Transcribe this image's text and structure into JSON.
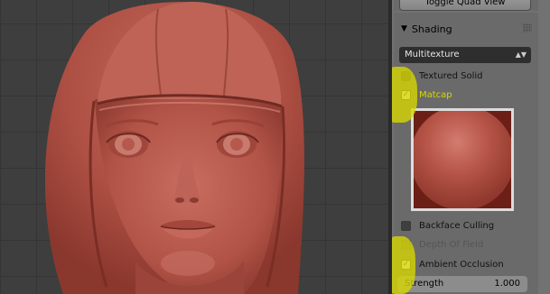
{
  "panel": {
    "toggle_quad_view": "Toggle Quad View",
    "shading_header": "Shading",
    "shading_mode": "Multitexture",
    "options": {
      "textured_solid": "Textured Solid",
      "matcap": "Matcap",
      "backface_culling": "Backface Culling",
      "depth_of_field": "Depth Of Field",
      "ambient_occlusion": "Ambient Occlusion"
    },
    "strength_label": "Strength",
    "strength_value": "1.000"
  },
  "icons": {
    "expand": "triangle-down-icon",
    "drag": "drag-dots-icon",
    "dropdown": "updown-arrow-icon"
  },
  "colors": {
    "sculpt": "#b55a4e",
    "highlight": "#d8d800",
    "viewport_bg": "#3e3e3e",
    "panel_bg": "#727272"
  }
}
